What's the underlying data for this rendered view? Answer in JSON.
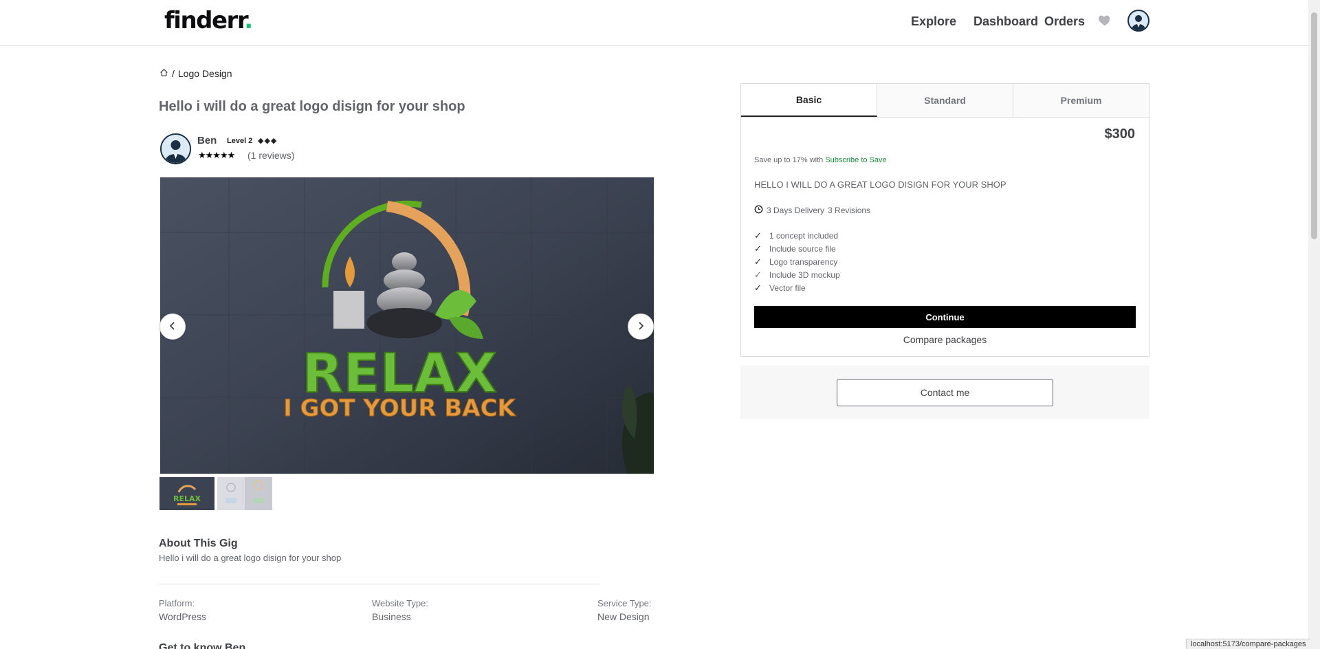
{
  "header": {
    "logo_text": "finderr",
    "logo_dot": ".",
    "nav": {
      "explore": "Explore",
      "dashboard": "Dashboard",
      "orders": "Orders"
    },
    "icons": [
      "heart-icon",
      "avatar"
    ]
  },
  "breadcrumb": {
    "separator": "/",
    "category": "Logo Design"
  },
  "gig": {
    "title": "Hello i will do a great logo disign for your shop",
    "seller": {
      "name": "Ben",
      "level": "Level 2",
      "level_diamonds": "◆◆◆",
      "stars": "★★★★★",
      "reviews": "(1 reviews)"
    },
    "gallery": {
      "main_headline": "RELAX",
      "main_subline": "I GOT YOUR BACK",
      "thumb_1_headline": "RELAX",
      "prev_icon": "chevron-left-icon",
      "next_icon": "chevron-right-icon"
    },
    "about": {
      "heading": "About This Gig",
      "text": "Hello i will do a great logo disign for your shop"
    },
    "meta": [
      {
        "label": "Platform:",
        "value": "WordPress"
      },
      {
        "label": "Website Type:",
        "value": "Business"
      },
      {
        "label": "Service Type:",
        "value": "New Design"
      }
    ],
    "next_section": "Get to know Ben"
  },
  "package": {
    "tabs": [
      "Basic",
      "Standard",
      "Premium"
    ],
    "active_tab": "Basic",
    "price": "$300",
    "save_text": "Save up to 17% with ",
    "save_link": "Subscribe to Save",
    "description": "HELLO I WILL DO A GREAT LOGO DISIGN FOR YOUR SHOP",
    "delivery": "3 Days Delivery",
    "revisions": "3 Revisions",
    "features": [
      " 1 concept included",
      "Include source file",
      "Logo transparency",
      "Include 3D mockup",
      "Vector file"
    ],
    "continue_label": "Continue",
    "compare_label": "Compare packages"
  },
  "contact": {
    "label": "Contact me"
  },
  "status_bar": {
    "url": "localhost:5173/compare-packages"
  },
  "colors": {
    "brand_accent": "#1dbf73",
    "link_green": "#1a8b3c",
    "primary_button": "#000000"
  }
}
